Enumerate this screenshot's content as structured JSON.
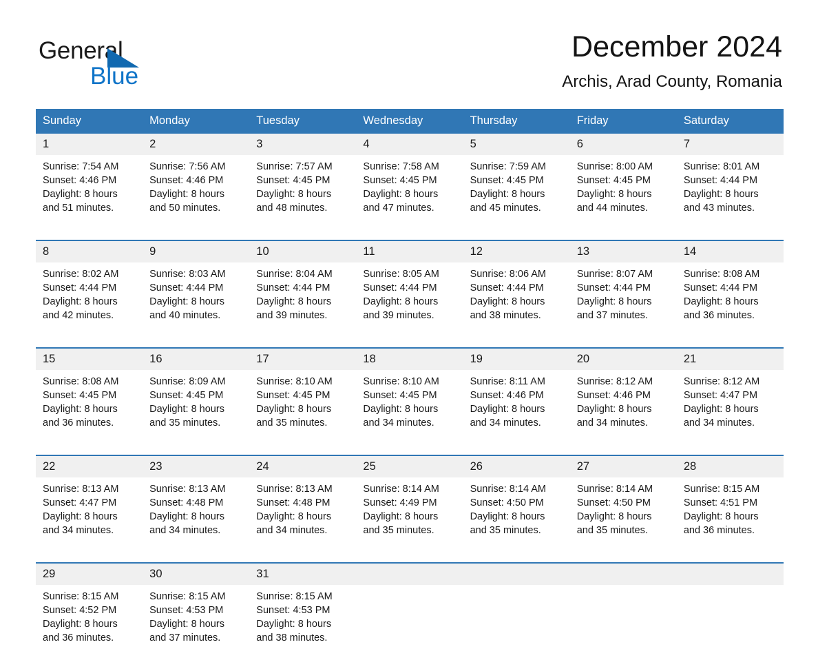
{
  "logo": {
    "word_top": "General",
    "word_bottom": "Blue",
    "triangle_icon": "logo-triangle-icon",
    "brand_blue": "#0f74c8",
    "triangle_blue": "#1169b0"
  },
  "header": {
    "title": "December 2024",
    "subtitle": "Archis, Arad County, Romania"
  },
  "theme": {
    "header_bg": "#3077b5",
    "header_text": "#ffffff",
    "daynum_bg": "#f0f0f0",
    "cell_bg": "#ffffff",
    "text": "#1a1a1a"
  },
  "calendar": {
    "weekday_headers": [
      "Sunday",
      "Monday",
      "Tuesday",
      "Wednesday",
      "Thursday",
      "Friday",
      "Saturday"
    ],
    "weeks": [
      [
        {
          "day": "1",
          "sunrise": "Sunrise: 7:54 AM",
          "sunset": "Sunset: 4:46 PM",
          "daylight_line1": "Daylight: 8 hours",
          "daylight_line2": "and 51 minutes."
        },
        {
          "day": "2",
          "sunrise": "Sunrise: 7:56 AM",
          "sunset": "Sunset: 4:46 PM",
          "daylight_line1": "Daylight: 8 hours",
          "daylight_line2": "and 50 minutes."
        },
        {
          "day": "3",
          "sunrise": "Sunrise: 7:57 AM",
          "sunset": "Sunset: 4:45 PM",
          "daylight_line1": "Daylight: 8 hours",
          "daylight_line2": "and 48 minutes."
        },
        {
          "day": "4",
          "sunrise": "Sunrise: 7:58 AM",
          "sunset": "Sunset: 4:45 PM",
          "daylight_line1": "Daylight: 8 hours",
          "daylight_line2": "and 47 minutes."
        },
        {
          "day": "5",
          "sunrise": "Sunrise: 7:59 AM",
          "sunset": "Sunset: 4:45 PM",
          "daylight_line1": "Daylight: 8 hours",
          "daylight_line2": "and 45 minutes."
        },
        {
          "day": "6",
          "sunrise": "Sunrise: 8:00 AM",
          "sunset": "Sunset: 4:45 PM",
          "daylight_line1": "Daylight: 8 hours",
          "daylight_line2": "and 44 minutes."
        },
        {
          "day": "7",
          "sunrise": "Sunrise: 8:01 AM",
          "sunset": "Sunset: 4:44 PM",
          "daylight_line1": "Daylight: 8 hours",
          "daylight_line2": "and 43 minutes."
        }
      ],
      [
        {
          "day": "8",
          "sunrise": "Sunrise: 8:02 AM",
          "sunset": "Sunset: 4:44 PM",
          "daylight_line1": "Daylight: 8 hours",
          "daylight_line2": "and 42 minutes."
        },
        {
          "day": "9",
          "sunrise": "Sunrise: 8:03 AM",
          "sunset": "Sunset: 4:44 PM",
          "daylight_line1": "Daylight: 8 hours",
          "daylight_line2": "and 40 minutes."
        },
        {
          "day": "10",
          "sunrise": "Sunrise: 8:04 AM",
          "sunset": "Sunset: 4:44 PM",
          "daylight_line1": "Daylight: 8 hours",
          "daylight_line2": "and 39 minutes."
        },
        {
          "day": "11",
          "sunrise": "Sunrise: 8:05 AM",
          "sunset": "Sunset: 4:44 PM",
          "daylight_line1": "Daylight: 8 hours",
          "daylight_line2": "and 39 minutes."
        },
        {
          "day": "12",
          "sunrise": "Sunrise: 8:06 AM",
          "sunset": "Sunset: 4:44 PM",
          "daylight_line1": "Daylight: 8 hours",
          "daylight_line2": "and 38 minutes."
        },
        {
          "day": "13",
          "sunrise": "Sunrise: 8:07 AM",
          "sunset": "Sunset: 4:44 PM",
          "daylight_line1": "Daylight: 8 hours",
          "daylight_line2": "and 37 minutes."
        },
        {
          "day": "14",
          "sunrise": "Sunrise: 8:08 AM",
          "sunset": "Sunset: 4:44 PM",
          "daylight_line1": "Daylight: 8 hours",
          "daylight_line2": "and 36 minutes."
        }
      ],
      [
        {
          "day": "15",
          "sunrise": "Sunrise: 8:08 AM",
          "sunset": "Sunset: 4:45 PM",
          "daylight_line1": "Daylight: 8 hours",
          "daylight_line2": "and 36 minutes."
        },
        {
          "day": "16",
          "sunrise": "Sunrise: 8:09 AM",
          "sunset": "Sunset: 4:45 PM",
          "daylight_line1": "Daylight: 8 hours",
          "daylight_line2": "and 35 minutes."
        },
        {
          "day": "17",
          "sunrise": "Sunrise: 8:10 AM",
          "sunset": "Sunset: 4:45 PM",
          "daylight_line1": "Daylight: 8 hours",
          "daylight_line2": "and 35 minutes."
        },
        {
          "day": "18",
          "sunrise": "Sunrise: 8:10 AM",
          "sunset": "Sunset: 4:45 PM",
          "daylight_line1": "Daylight: 8 hours",
          "daylight_line2": "and 34 minutes."
        },
        {
          "day": "19",
          "sunrise": "Sunrise: 8:11 AM",
          "sunset": "Sunset: 4:46 PM",
          "daylight_line1": "Daylight: 8 hours",
          "daylight_line2": "and 34 minutes."
        },
        {
          "day": "20",
          "sunrise": "Sunrise: 8:12 AM",
          "sunset": "Sunset: 4:46 PM",
          "daylight_line1": "Daylight: 8 hours",
          "daylight_line2": "and 34 minutes."
        },
        {
          "day": "21",
          "sunrise": "Sunrise: 8:12 AM",
          "sunset": "Sunset: 4:47 PM",
          "daylight_line1": "Daylight: 8 hours",
          "daylight_line2": "and 34 minutes."
        }
      ],
      [
        {
          "day": "22",
          "sunrise": "Sunrise: 8:13 AM",
          "sunset": "Sunset: 4:47 PM",
          "daylight_line1": "Daylight: 8 hours",
          "daylight_line2": "and 34 minutes."
        },
        {
          "day": "23",
          "sunrise": "Sunrise: 8:13 AM",
          "sunset": "Sunset: 4:48 PM",
          "daylight_line1": "Daylight: 8 hours",
          "daylight_line2": "and 34 minutes."
        },
        {
          "day": "24",
          "sunrise": "Sunrise: 8:13 AM",
          "sunset": "Sunset: 4:48 PM",
          "daylight_line1": "Daylight: 8 hours",
          "daylight_line2": "and 34 minutes."
        },
        {
          "day": "25",
          "sunrise": "Sunrise: 8:14 AM",
          "sunset": "Sunset: 4:49 PM",
          "daylight_line1": "Daylight: 8 hours",
          "daylight_line2": "and 35 minutes."
        },
        {
          "day": "26",
          "sunrise": "Sunrise: 8:14 AM",
          "sunset": "Sunset: 4:50 PM",
          "daylight_line1": "Daylight: 8 hours",
          "daylight_line2": "and 35 minutes."
        },
        {
          "day": "27",
          "sunrise": "Sunrise: 8:14 AM",
          "sunset": "Sunset: 4:50 PM",
          "daylight_line1": "Daylight: 8 hours",
          "daylight_line2": "and 35 minutes."
        },
        {
          "day": "28",
          "sunrise": "Sunrise: 8:15 AM",
          "sunset": "Sunset: 4:51 PM",
          "daylight_line1": "Daylight: 8 hours",
          "daylight_line2": "and 36 minutes."
        }
      ],
      [
        {
          "day": "29",
          "sunrise": "Sunrise: 8:15 AM",
          "sunset": "Sunset: 4:52 PM",
          "daylight_line1": "Daylight: 8 hours",
          "daylight_line2": "and 36 minutes."
        },
        {
          "day": "30",
          "sunrise": "Sunrise: 8:15 AM",
          "sunset": "Sunset: 4:53 PM",
          "daylight_line1": "Daylight: 8 hours",
          "daylight_line2": "and 37 minutes."
        },
        {
          "day": "31",
          "sunrise": "Sunrise: 8:15 AM",
          "sunset": "Sunset: 4:53 PM",
          "daylight_line1": "Daylight: 8 hours",
          "daylight_line2": "and 38 minutes."
        },
        {
          "day": "",
          "sunrise": "",
          "sunset": "",
          "daylight_line1": "",
          "daylight_line2": ""
        },
        {
          "day": "",
          "sunrise": "",
          "sunset": "",
          "daylight_line1": "",
          "daylight_line2": ""
        },
        {
          "day": "",
          "sunrise": "",
          "sunset": "",
          "daylight_line1": "",
          "daylight_line2": ""
        },
        {
          "day": "",
          "sunrise": "",
          "sunset": "",
          "daylight_line1": "",
          "daylight_line2": ""
        }
      ]
    ]
  }
}
